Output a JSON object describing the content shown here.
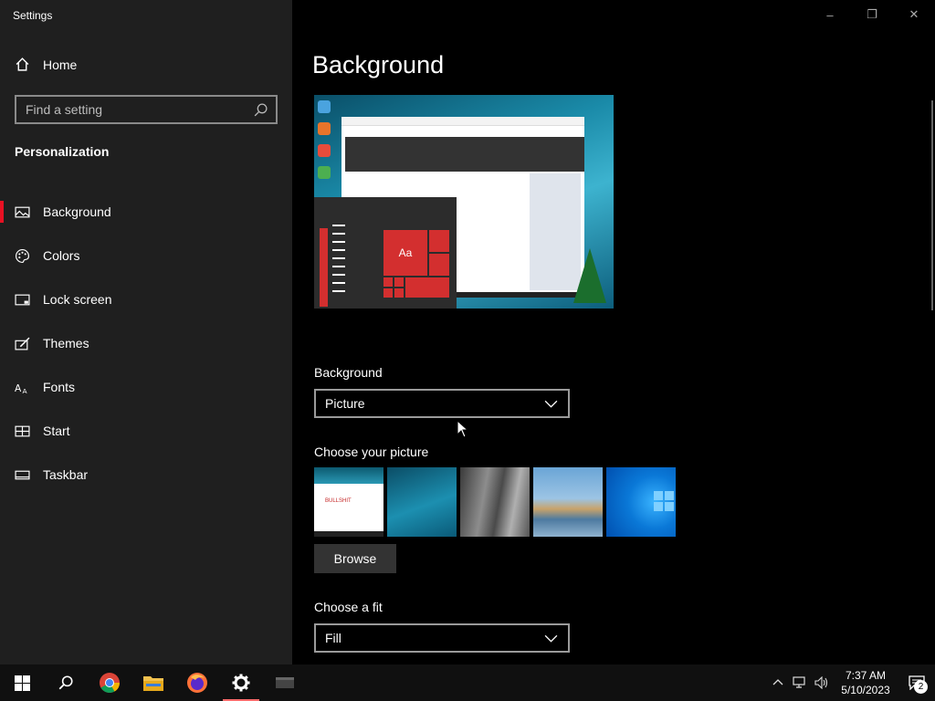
{
  "app": {
    "title": "Settings"
  },
  "sidebar": {
    "home_label": "Home",
    "search_placeholder": "Find a setting",
    "section_title": "Personalization",
    "items": [
      {
        "label": "Background",
        "icon": "picture-icon",
        "active": true
      },
      {
        "label": "Colors",
        "icon": "palette-icon",
        "active": false
      },
      {
        "label": "Lock screen",
        "icon": "lock-screen-icon",
        "active": false
      },
      {
        "label": "Themes",
        "icon": "brush-icon",
        "active": false
      },
      {
        "label": "Fonts",
        "icon": "font-icon",
        "active": false
      },
      {
        "label": "Start",
        "icon": "start-icon",
        "active": false
      },
      {
        "label": "Taskbar",
        "icon": "taskbar-icon",
        "active": false
      }
    ]
  },
  "window_controls": {
    "minimize": "–",
    "restore": "❐",
    "close": "✕"
  },
  "main": {
    "title": "Background",
    "preview": {
      "sample_text": "Aa",
      "preview_label": "BULLSHIT"
    },
    "background_label": "Background",
    "background_value": "Picture",
    "choose_picture_label": "Choose your picture",
    "browse_label": "Browse",
    "fit_label": "Choose a fit",
    "fit_value": "Fill"
  },
  "taskbar": {
    "time": "7:37 AM",
    "date": "5/10/2023",
    "notifications": "2"
  },
  "colors": {
    "accent": "#e81123",
    "tile_red": "#d32f2f"
  }
}
